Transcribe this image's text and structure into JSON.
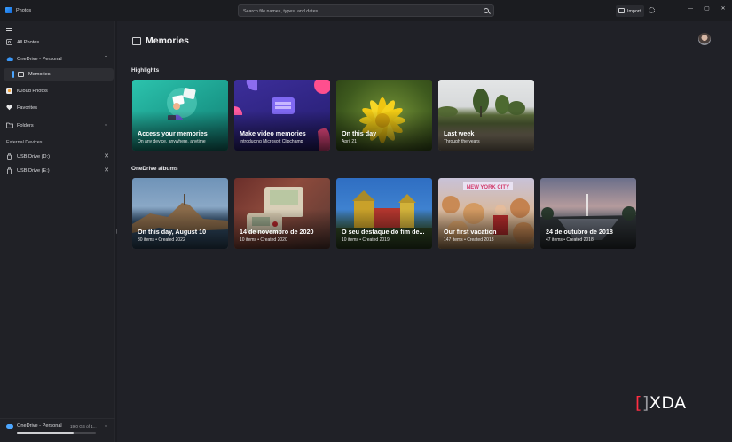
{
  "app": {
    "title": "Photos"
  },
  "search": {
    "placeholder": "Search file names, types, and dates"
  },
  "toolbar": {
    "import_label": "Import",
    "minimize": "—",
    "maximize": "▢",
    "close": "✕"
  },
  "sidebar": {
    "items": [
      {
        "label": "All Photos",
        "icon": "images-icon"
      },
      {
        "label": "OneDrive - Personal",
        "icon": "cloud-icon",
        "chevron": "⌃"
      },
      {
        "label": "Memories",
        "icon": "memories-icon",
        "selected": true
      },
      {
        "label": "iCloud Photos",
        "icon": "icloud-icon"
      },
      {
        "label": "Favorites",
        "icon": "heart-icon"
      },
      {
        "label": "Folders",
        "icon": "folder-icon",
        "chevron": "⌄"
      }
    ],
    "external_header": "External Devices",
    "devices": [
      {
        "label": "USB Drive (D:)",
        "icon": "usb-icon",
        "close": "✕"
      },
      {
        "label": "USB Drive (E:)",
        "icon": "usb-icon",
        "close": "✕"
      }
    ],
    "footer": {
      "account": "OneDrive - Personal",
      "storage": "19.0 GB of 1...",
      "chevron": "⌄",
      "storage_fraction": 0.72
    }
  },
  "main": {
    "title": "Memories",
    "highlights_title": "Highlights",
    "highlights": [
      {
        "title": "Access your memories",
        "subtitle": "On any device, anywhere, anytime"
      },
      {
        "title": "Make video memories",
        "subtitle": "Introducing Microsoft Clipchamp"
      },
      {
        "title": "On this day",
        "subtitle": "April 21"
      },
      {
        "title": "Last week",
        "subtitle": "Through the years"
      }
    ],
    "albums_title": "OneDrive albums",
    "albums": [
      {
        "title": "On this day, August 10",
        "subtitle": "30 items • Created 2022"
      },
      {
        "title": "14 de novembro de 2020",
        "subtitle": "10 items • Created 2020"
      },
      {
        "title": "O seu destaque do fim de...",
        "subtitle": "10 items • Created 2019"
      },
      {
        "title": "Our first vacation",
        "subtitle": "147 items • Created 2018"
      },
      {
        "title": "24 de outubro de 2018",
        "subtitle": "47 items • Created 2018"
      }
    ]
  },
  "watermark": {
    "open": "[",
    "close": "]",
    "text": "XDA"
  },
  "colors": {
    "accent": "#4ca6ff",
    "background": "#202127",
    "sidebar": "#202126",
    "watermark_red": "#ff2e42"
  }
}
